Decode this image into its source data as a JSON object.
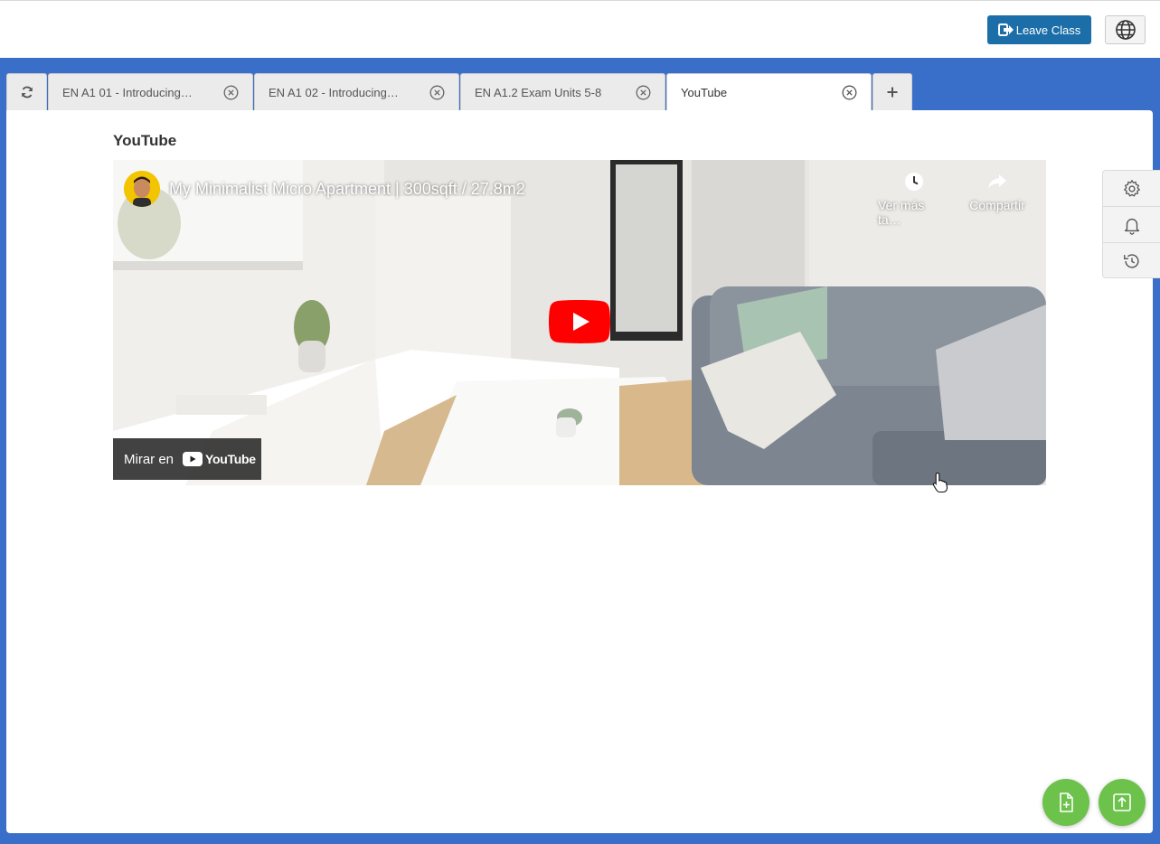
{
  "header": {
    "leave_class_label": "Leave Class",
    "leave_icon": "sign-out-icon",
    "language_icon": "globe-icon"
  },
  "tabs": [
    {
      "label": "EN A1 01 - Introducing…",
      "active": false
    },
    {
      "label": "EN A1 02 - Introducing…",
      "active": false
    },
    {
      "label": "EN A1.2 Exam Units 5-8",
      "active": false
    },
    {
      "label": "YouTube",
      "active": true
    }
  ],
  "panel": {
    "title": "YouTube"
  },
  "video": {
    "title": "My Minimalist Micro Apartment | 300sqft / 27.8m2",
    "watch_later_label": "Ver más ta…",
    "share_label": "Compartir",
    "watch_on_label": "Mirar en",
    "youtube_logo_text": "YouTube"
  },
  "side_tools": [
    "gear-icon",
    "bell-icon",
    "history-icon"
  ],
  "colors": {
    "topbar_button": "#1b6ea8",
    "workspace_bg": "#3a6fc9",
    "fab_green": "#6cc24a",
    "youtube_red": "#ff0000"
  }
}
